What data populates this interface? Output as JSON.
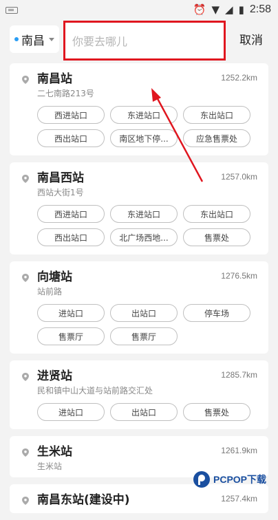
{
  "status": {
    "time": "2:58"
  },
  "header": {
    "city": "南昌",
    "search_placeholder": "你要去哪儿",
    "cancel": "取消"
  },
  "stations": [
    {
      "name": "南昌站",
      "distance": "1252.2km",
      "address": "二七南路213号",
      "exits": [
        "西进站口",
        "东进站口",
        "东出站口",
        "西出站口",
        "南区地下停...",
        "应急售票处"
      ]
    },
    {
      "name": "南昌西站",
      "distance": "1257.0km",
      "address": "西站大街1号",
      "exits": [
        "西进站口",
        "东进站口",
        "东出站口",
        "西出站口",
        "北广场西地...",
        "售票处"
      ]
    },
    {
      "name": "向塘站",
      "distance": "1276.5km",
      "address": "站前路",
      "exits": [
        "进站口",
        "出站口",
        "停车场",
        "售票厅",
        "售票厅"
      ]
    },
    {
      "name": "进贤站",
      "distance": "1285.7km",
      "address": "民和镇中山大道与站前路交汇处",
      "exits": [
        "进站口",
        "出站口",
        "售票处"
      ]
    },
    {
      "name": "生米站",
      "distance": "1261.9km",
      "address": "生米站",
      "exits": []
    },
    {
      "name": "南昌东站(建设中)",
      "distance": "1257.4km",
      "address": "",
      "exits": []
    }
  ],
  "watermark": {
    "text": "PCPOP下载"
  },
  "colors": {
    "highlight": "#e0161f",
    "accent": "#2a9df4"
  }
}
